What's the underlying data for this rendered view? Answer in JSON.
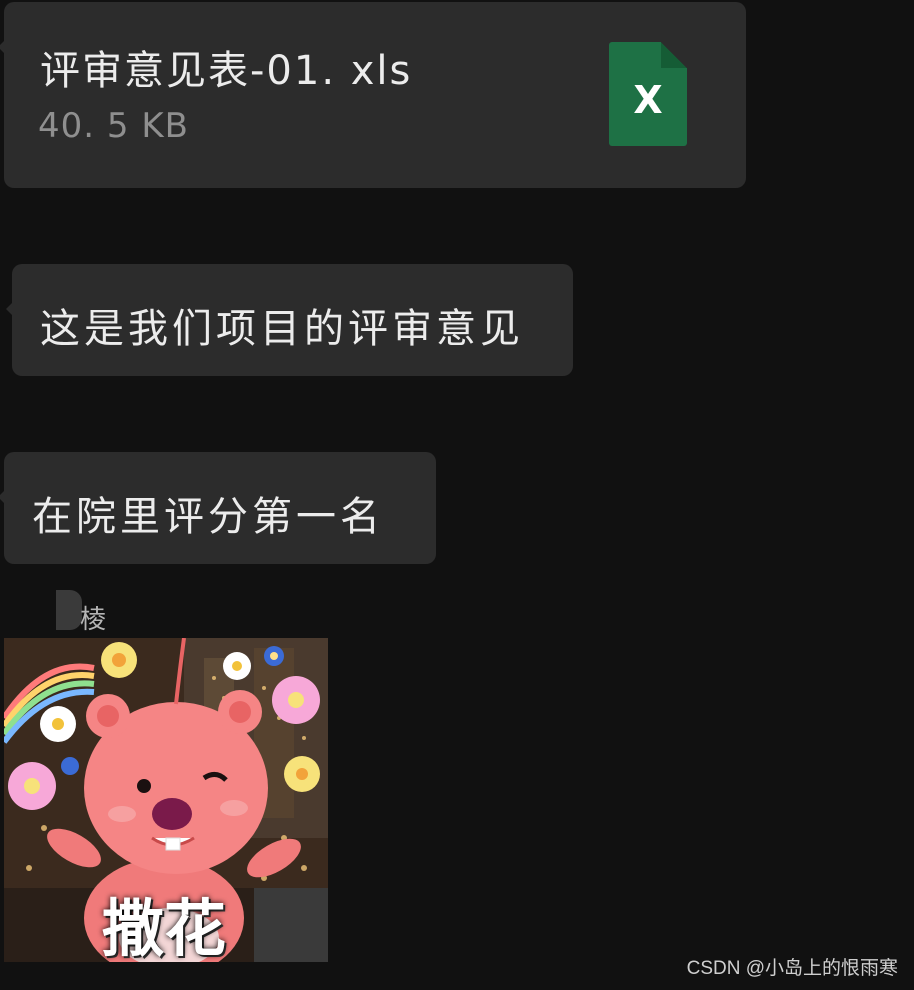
{
  "messages": {
    "file": {
      "name": "评审意见表-01. xls",
      "size": "40. 5 KB",
      "icon": "excel-file-icon",
      "icon_letter": "X",
      "icon_color": "#1e7145"
    },
    "text_1": "这是我们项目的评审意见",
    "text_2": "在院里评分第一名",
    "sender_name": "棱",
    "sticker": {
      "caption": "撒花",
      "description_icon": "pink-beaver-flowers-sticker"
    }
  },
  "watermark": "CSDN @小岛上的恨雨寒",
  "colors": {
    "background": "#111111",
    "bubble": "#2c2c2c",
    "text": "#ececec",
    "muted_text": "#8f8f8f"
  }
}
